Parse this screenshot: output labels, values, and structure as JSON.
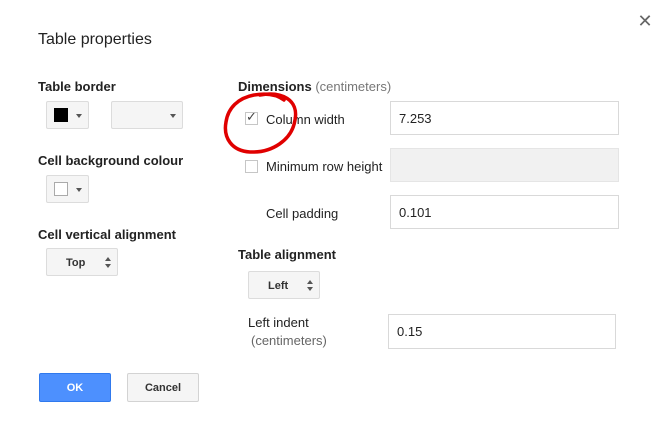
{
  "dialog": {
    "title": "Table properties"
  },
  "left": {
    "table_border_label": "Table border",
    "cell_background_label": "Cell background colour",
    "cell_vertical_alignment_label": "Cell vertical alignment",
    "vertical_alignment_value": "Top"
  },
  "dimensions": {
    "label": "Dimensions",
    "unit": "(centimeters)",
    "column_width_label": "Column width",
    "column_width_checked": true,
    "column_width_value": "7.253",
    "min_row_height_label": "Minimum row height",
    "min_row_height_checked": false,
    "min_row_height_value": "",
    "cell_padding_label": "Cell padding",
    "cell_padding_value": "0.101"
  },
  "alignment": {
    "label": "Table alignment",
    "value": "Left",
    "left_indent_label": "Left indent",
    "left_indent_unit": "(centimeters)",
    "left_indent_value": "0.15"
  },
  "buttons": {
    "ok": "OK",
    "cancel": "Cancel"
  },
  "colors": {
    "border_color_swatch": "#000000",
    "cell_background_swatch": "#ffffff",
    "primary": "#4d90fe",
    "annotation": "#e00000"
  },
  "icons": {
    "close": "close-icon",
    "check": "check-icon"
  }
}
